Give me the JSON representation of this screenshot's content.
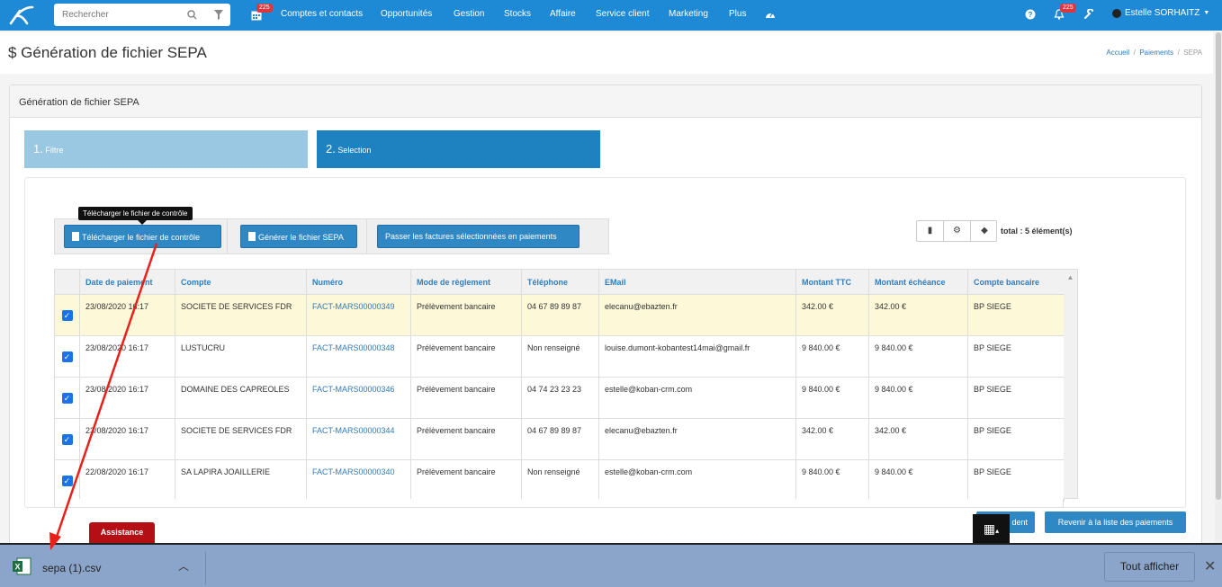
{
  "search": {
    "placeholder": "Rechercher"
  },
  "nav": {
    "calendar_badge": "225",
    "items": [
      "Comptes et contacts",
      "Opportunités",
      "Gestion",
      "Stocks",
      "Affaire",
      "Service client",
      "Marketing",
      "Plus"
    ],
    "notif_badge": "225",
    "user_name": "Estelle SORHAITZ"
  },
  "page": {
    "title": "$ Génération de fichier SEPA",
    "breadcrumb": [
      "Accueil",
      "Paiements",
      "SEPA"
    ]
  },
  "panel": {
    "heading": "Génération de fichier SEPA",
    "steps": [
      {
        "num": "1.",
        "label": "Filtre"
      },
      {
        "num": "2.",
        "label": "Selection"
      }
    ]
  },
  "actions": {
    "tooltip": "Télécharger le fichier de contrôle",
    "download_control": "Télécharger le fichier de contrôle",
    "generate_sepa": "Générer le fichier SEPA",
    "pass_invoices": "Passer les factures sélectionnées en paiements"
  },
  "total": "total : 5 élément(s)",
  "table": {
    "headers": [
      "Date de paiement",
      "Compte",
      "Numéro",
      "Mode de règlement",
      "Téléphone",
      "EMail",
      "Montant TTC",
      "Montant échéance",
      "Compte bancaire"
    ],
    "rows": [
      [
        "23/08/2020 16:17",
        "SOCIETE DE SERVICES FDR",
        "FACT-MARS00000349",
        "Prélèvement bancaire",
        "04 67 89 89 87",
        "elecanu@ebazten.fr",
        "342.00 €",
        "342.00 €",
        "BP SIEGE"
      ],
      [
        "23/08/2020 16:17",
        "LUSTUCRU",
        "FACT-MARS00000348",
        "Prélèvement bancaire",
        "Non renseigné",
        "louise.dumont-kobantest14mai@gmail.fr",
        "9 840.00 €",
        "9 840.00 €",
        "BP SIEGE"
      ],
      [
        "23/08/2020 16:17",
        "DOMAINE DES CAPREOLES",
        "FACT-MARS00000346",
        "Prélèvement bancaire",
        "04 74 23 23 23",
        "estelle@koban-crm.com",
        "9 840.00 €",
        "9 840.00 €",
        "BP SIEGE"
      ],
      [
        "23/08/2020 16:17",
        "SOCIETE DE SERVICES FDR",
        "FACT-MARS00000344",
        "Prélèvement bancaire",
        "04 67 89 89 87",
        "elecanu@ebazten.fr",
        "342.00 €",
        "342.00 €",
        "BP SIEGE"
      ],
      [
        "22/08/2020 16:17",
        "SA LAPIRA JOAILLERIE",
        "FACT-MARS00000340",
        "Prélèvement bancaire",
        "Non renseigné",
        "estelle@koban-crm.com",
        "9 840.00 €",
        "9 840.00 €",
        "BP SIEGE"
      ]
    ]
  },
  "footer": {
    "prev_button": "dent",
    "back_button": "Revenir à la liste des paiements",
    "assist_tab": "Assistance"
  },
  "download": {
    "file_name": "sepa (1).csv",
    "show_all": "Tout afficher"
  },
  "colors": {
    "nav": "#1e8ad6",
    "primary_button": "#2f87c4",
    "highlight_row": "#fcf8d8",
    "annotation_arrow": "#e8201a"
  }
}
